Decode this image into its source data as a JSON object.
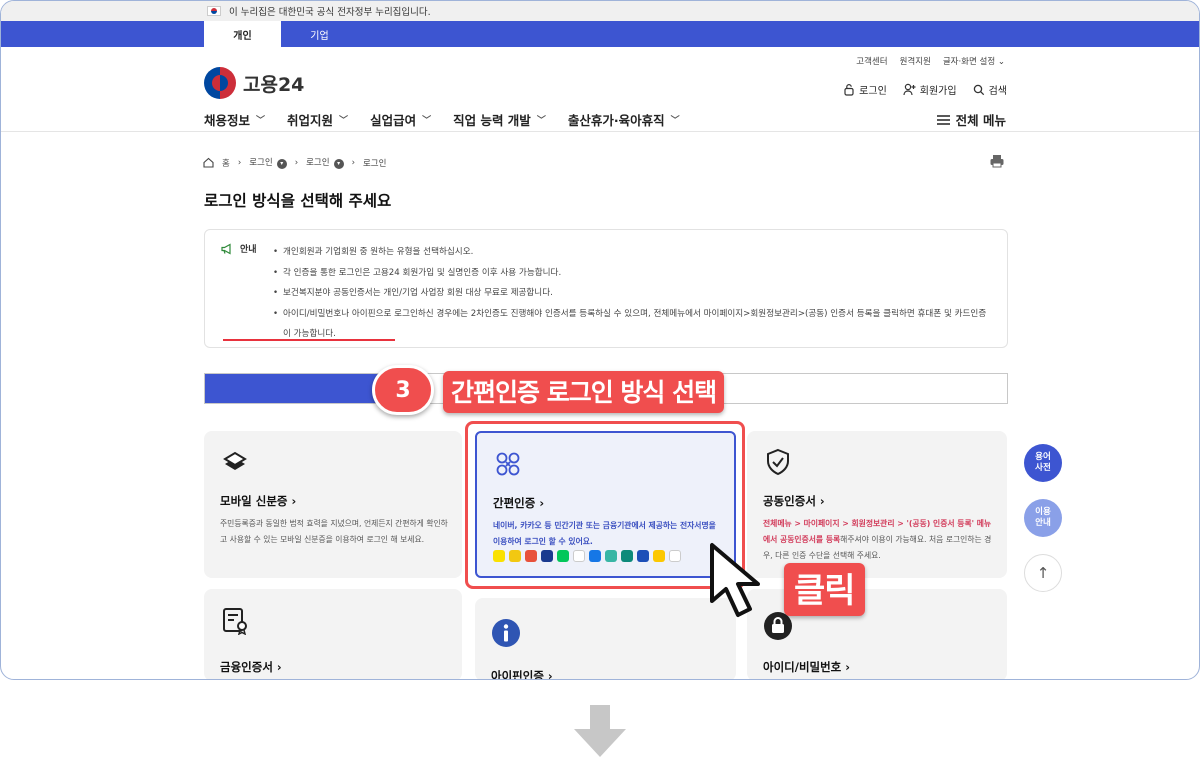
{
  "gov_banner": {
    "text": "이 누리집은 대한민국 공식 전자정부 누리집입니다."
  },
  "tabs": [
    "개인",
    "기업"
  ],
  "util_links": [
    "고객센터",
    "원격지원",
    "글자·화면 설정 ⌄"
  ],
  "logo_text": "고용24",
  "account": {
    "login": "로그인",
    "signup": "회원가입",
    "search": "검색"
  },
  "gnb": [
    "채용정보",
    "취업지원",
    "실업급여",
    "직업 능력 개발",
    "출산휴가·육아휴직"
  ],
  "all_menu": "전체 메뉴",
  "breadcrumb": {
    "home": "홈",
    "c1": "로그인",
    "c2": "로그인",
    "c3": "로그인"
  },
  "page_title": "로그인 방식을 선택해 주세요",
  "notice": {
    "label": "안내",
    "items": [
      "개인회원과 기업회원 중 원하는 유형을 선택하십시오.",
      "각 인증을 통한 로그인은 고용24 회원가입 및 실명인증 이후 사용 가능합니다.",
      "보건복지분야 공동인증서는 개인/기업 사업장 회원 대상 무료로 제공합니다.",
      "아이디/비밀번호나 아이핀으로 로그인하신 경우에는 2차인증도 진행해야 인증서를 등록하실 수 있으며, 전체메뉴에서 마이페이지>회원정보관리>(공동) 인증서 등록을 클릭하면 휴대폰 및 카드인증이 가능합니다."
    ]
  },
  "annotation": {
    "step_number": "3",
    "step_title": "간편인증 로그인 방식 선택",
    "click_label": "클릭"
  },
  "cards": {
    "mobile": {
      "title": "모바일 신분증 ›",
      "desc": "주민등록증과 동일한 법적 효력을 지녔으며, 언제든지 간편하게 확인하고 사용할 수 있는 모바일 신분증을 이용하여 로그인 해 보세요."
    },
    "simple": {
      "title": "간편인증 ›",
      "desc": "네이버, 카카오 등 민간기관 또는 금융기관에서 제공하는 전자서명을 이용하여 로그인 할 수 있어요."
    },
    "cert": {
      "title": "공동인증서 ›",
      "desc_hl": "전체메뉴 > 마이페이지 > 회원정보관리 > '(공동) 인증서 등록' 메뉴에서 공동인증서를 등록",
      "desc_rest": "해주셔야 이용이 가능해요. 처음 로그인하는 경우, 다른 인증 수단을 선택해 주세요."
    },
    "fin": {
      "title": "금융인증서 ›"
    },
    "ipin": {
      "title": "아이핀인증 ›"
    },
    "id": {
      "title": "아이디/비밀번호 ›"
    }
  },
  "side_buttons": {
    "dict": "용어\n사전",
    "guide": "이용\n안내",
    "top": "↑"
  },
  "colors": {
    "brand_blue": "#3d55d1",
    "annotation_red": "#f04e4e"
  }
}
